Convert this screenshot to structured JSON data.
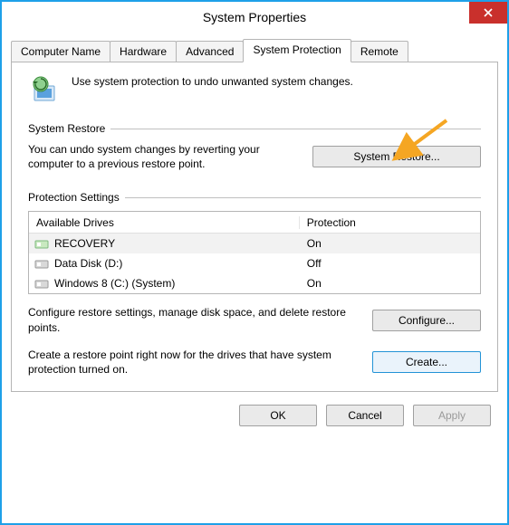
{
  "window": {
    "title": "System Properties"
  },
  "tabs": [
    {
      "label": "Computer Name"
    },
    {
      "label": "Hardware"
    },
    {
      "label": "Advanced"
    },
    {
      "label": "System Protection"
    },
    {
      "label": "Remote"
    }
  ],
  "intro": "Use system protection to undo unwanted system changes.",
  "groups": {
    "restore": {
      "title": "System Restore",
      "text": "You can undo system changes by reverting your computer to a previous restore point.",
      "button": "System Restore..."
    },
    "protection": {
      "title": "Protection Settings",
      "columns": {
        "drives": "Available Drives",
        "protection": "Protection"
      },
      "rows": [
        {
          "icon": "drive-green",
          "name": "RECOVERY",
          "protection": "On"
        },
        {
          "icon": "drive-gray",
          "name": "Data Disk (D:)",
          "protection": "Off"
        },
        {
          "icon": "drive-gray",
          "name": "Windows 8 (C:) (System)",
          "protection": "On"
        }
      ],
      "configure_text": "Configure restore settings, manage disk space, and delete restore points.",
      "configure_button": "Configure...",
      "create_text": "Create a restore point right now for the drives that have system protection turned on.",
      "create_button": "Create..."
    }
  },
  "dialog_buttons": {
    "ok": "OK",
    "cancel": "Cancel",
    "apply": "Apply"
  }
}
